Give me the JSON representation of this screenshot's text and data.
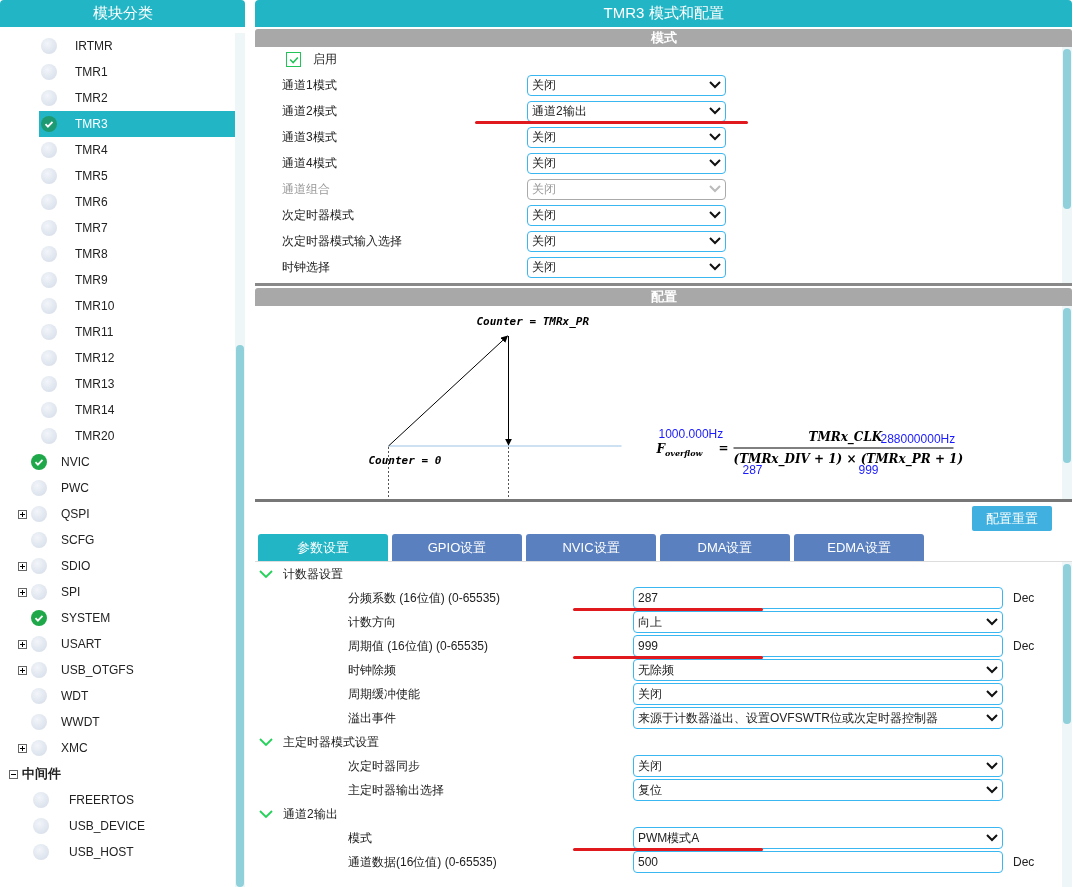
{
  "sidebar": {
    "title": "模块分类",
    "items": [
      {
        "children": [
          {
            "label": "IRTMR",
            "checked": false,
            "selected": false
          },
          {
            "label": "TMR1",
            "checked": false,
            "selected": false
          },
          {
            "label": "TMR2",
            "checked": false,
            "selected": false
          },
          {
            "label": "TMR3",
            "checked": true,
            "selected": true
          },
          {
            "label": "TMR4",
            "checked": false,
            "selected": false
          },
          {
            "label": "TMR5",
            "checked": false,
            "selected": false
          },
          {
            "label": "TMR6",
            "checked": false,
            "selected": false
          },
          {
            "label": "TMR7",
            "checked": false,
            "selected": false
          },
          {
            "label": "TMR8",
            "checked": false,
            "selected": false
          },
          {
            "label": "TMR9",
            "checked": false,
            "selected": false
          },
          {
            "label": "TMR10",
            "checked": false,
            "selected": false
          },
          {
            "label": "TMR11",
            "checked": false,
            "selected": false
          },
          {
            "label": "TMR12",
            "checked": false,
            "selected": false
          },
          {
            "label": "TMR13",
            "checked": false,
            "selected": false
          },
          {
            "label": "TMR14",
            "checked": false,
            "selected": false
          },
          {
            "label": "TMR20",
            "checked": false,
            "selected": false
          }
        ]
      },
      {
        "label": "NVIC",
        "checked": true,
        "selected": false
      },
      {
        "label": "PWC",
        "checked": false,
        "selected": false
      },
      {
        "label": "QSPI",
        "checked": false,
        "selected": false,
        "expanded": false
      },
      {
        "label": "SCFG",
        "checked": false,
        "selected": false
      },
      {
        "label": "SDIO",
        "checked": false,
        "selected": false,
        "expanded": false
      },
      {
        "label": "SPI",
        "checked": false,
        "selected": false,
        "expanded": false
      },
      {
        "label": "SYSTEM",
        "checked": true,
        "selected": false
      },
      {
        "label": "USART",
        "checked": false,
        "selected": false,
        "expanded": false
      },
      {
        "label": "USB_OTGFS",
        "checked": false,
        "selected": false,
        "expanded": false
      },
      {
        "label": "WDT",
        "checked": false,
        "selected": false
      },
      {
        "label": "WWDT",
        "checked": false,
        "selected": false
      },
      {
        "label": "XMC",
        "checked": false,
        "selected": false,
        "expanded": false
      },
      {
        "label": "中间件",
        "kind": "category",
        "expanded": true,
        "children": [
          {
            "label": "FREERTOS",
            "checked": false,
            "selected": false
          },
          {
            "label": "USB_DEVICE",
            "checked": false,
            "selected": false
          },
          {
            "label": "USB_HOST",
            "checked": false,
            "selected": false
          }
        ]
      }
    ]
  },
  "window": {
    "title": "TMR3 模式和配置"
  },
  "mode": {
    "title": "模式",
    "enable": {
      "label": "启用",
      "checked": true
    },
    "rows": [
      {
        "label": "通道1模式",
        "value": "关闭",
        "disabled": false,
        "underlined": false
      },
      {
        "label": "通道2模式",
        "value": "通道2输出",
        "disabled": false,
        "underlined": true
      },
      {
        "label": "通道3模式",
        "value": "关闭",
        "disabled": false,
        "underlined": false
      },
      {
        "label": "通道4模式",
        "value": "关闭",
        "disabled": false,
        "underlined": false
      },
      {
        "label": "通道组合",
        "value": "关闭",
        "disabled": true,
        "underlined": false
      },
      {
        "label": "次定时器模式",
        "value": "关闭",
        "disabled": false,
        "underlined": false
      },
      {
        "label": "次定时器模式输入选择",
        "value": "关闭",
        "disabled": false,
        "underlined": false
      },
      {
        "label": "时钟选择",
        "value": "关闭",
        "disabled": false,
        "underlined": false
      }
    ]
  },
  "config": {
    "title": "配置",
    "diagram": {
      "top_label": "Counter = TMRx_PR",
      "bottom_label": "Counter = 0",
      "formula_left": "F",
      "equals": "=",
      "formula_sub": "overflow",
      "numerator": "TMRx_CLK",
      "denominator": "(TMRx_DIV + 1) × (TMRx_PR + 1)",
      "result": "1000.000Hz",
      "clock": "288000000Hz",
      "div": "287",
      "period": "999"
    },
    "reset_button": "配置重置",
    "tabs": [
      {
        "label": "参数设置",
        "selected": true
      },
      {
        "label": "GPIO设置",
        "selected": false
      },
      {
        "label": "NVIC设置",
        "selected": false
      },
      {
        "label": "DMA设置",
        "selected": false
      },
      {
        "label": "EDMA设置",
        "selected": false
      }
    ],
    "groups": [
      {
        "title": "计数器设置",
        "expanded": true,
        "rows": [
          {
            "kind": "input",
            "label": "分频系数 (16位值) (0-65535)",
            "value": "287",
            "unit": "Dec",
            "underlined": true
          },
          {
            "kind": "select",
            "label": "计数方向",
            "value": "向上",
            "underlined": false
          },
          {
            "kind": "input",
            "label": "周期值 (16位值) (0-65535)",
            "value": "999",
            "unit": "Dec",
            "underlined": true
          },
          {
            "kind": "select",
            "label": "时钟除频",
            "value": "无除频",
            "underlined": false
          },
          {
            "kind": "select",
            "label": "周期缓冲使能",
            "value": "关闭",
            "underlined": false
          },
          {
            "kind": "select",
            "label": "溢出事件",
            "value": "来源于计数器溢出、设置OVFSWTR位或次定时器控制器",
            "underlined": false
          }
        ]
      },
      {
        "title": "主定时器模式设置",
        "expanded": true,
        "rows": [
          {
            "kind": "select",
            "label": "次定时器同步",
            "value": "关闭",
            "underlined": false
          },
          {
            "kind": "select",
            "label": "主定时器输出选择",
            "value": "复位",
            "underlined": false
          }
        ]
      },
      {
        "title": "通道2输出",
        "expanded": true,
        "rows": [
          {
            "kind": "select",
            "label": "模式",
            "value": "PWM模式A",
            "underlined": true
          },
          {
            "kind": "input",
            "label": "通道数据(16位值) (0-65535)",
            "value": "500",
            "unit": "Dec",
            "underlined": false
          }
        ]
      }
    ]
  }
}
